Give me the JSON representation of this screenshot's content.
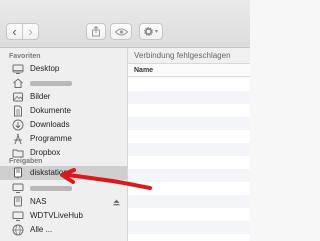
{
  "toolbar": {
    "back_glyph": "‹",
    "forward_glyph": "›",
    "gear_chevron": "▾"
  },
  "sidebar": {
    "favorites_header": "Favoriten",
    "favorites": [
      {
        "label": "Desktop",
        "icon": "desktop-icon"
      },
      {
        "label": "",
        "icon": "home-folder-icon",
        "redacted": true
      },
      {
        "label": "Bilder",
        "icon": "pictures-folder-icon"
      },
      {
        "label": "Dokumente",
        "icon": "documents-folder-icon"
      },
      {
        "label": "Downloads",
        "icon": "downloads-icon"
      },
      {
        "label": "Programme",
        "icon": "applications-icon"
      },
      {
        "label": "Dropbox",
        "icon": "dropbox-folder-icon"
      }
    ],
    "shared_header": "Freigaben",
    "shared": [
      {
        "label": "diskstation",
        "icon": "network-server-icon",
        "selected": true
      },
      {
        "label": "",
        "icon": "network-computer-icon",
        "redacted": true
      },
      {
        "label": "NAS",
        "icon": "network-server-icon"
      },
      {
        "label": "WDTVLiveHub",
        "icon": "network-server-icon"
      },
      {
        "label": "Alle ...",
        "icon": "network-globe-icon"
      }
    ]
  },
  "main": {
    "status_text": "Verbindung fehlgeschlagen",
    "column_name": "Name"
  },
  "colors": {
    "selection": "#cfcfcf",
    "annotation_arrow": "#d9191b"
  }
}
